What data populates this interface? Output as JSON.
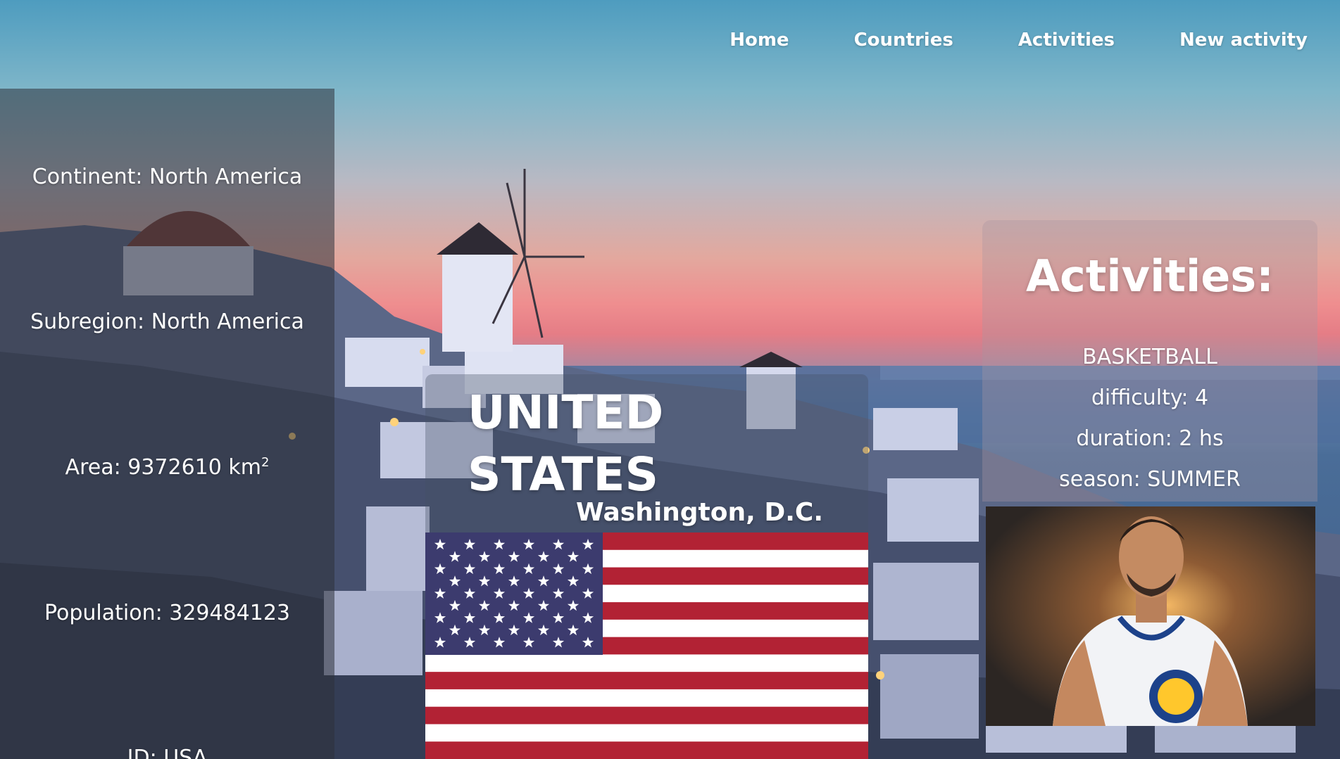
{
  "nav": {
    "items": [
      {
        "label": "Home"
      },
      {
        "label": "Countries"
      },
      {
        "label": "Activities"
      },
      {
        "label": "New activity"
      }
    ]
  },
  "country": {
    "name": "UNITED STATES",
    "capital": "Washington, D.C.",
    "flag_icon": "usa-flag-icon",
    "info": {
      "continent": "Continent: North America",
      "subregion": "Subregion: North America",
      "area": "Area: 9372610 km",
      "area_unit_sup": "2",
      "population": "Population: 329484123",
      "id": "ID: USA"
    }
  },
  "activities": {
    "title": "Activities:",
    "items": [
      {
        "name": "BASKETBALL",
        "difficulty": "difficulty: 4",
        "duration": "duration: 2 hs",
        "season": "season: SUMMER",
        "image_icon": "basketball-player-photo"
      }
    ]
  },
  "colors": {
    "flag_red": "#b22234",
    "flag_blue": "#3c3b6e",
    "text": "#ffffff"
  }
}
